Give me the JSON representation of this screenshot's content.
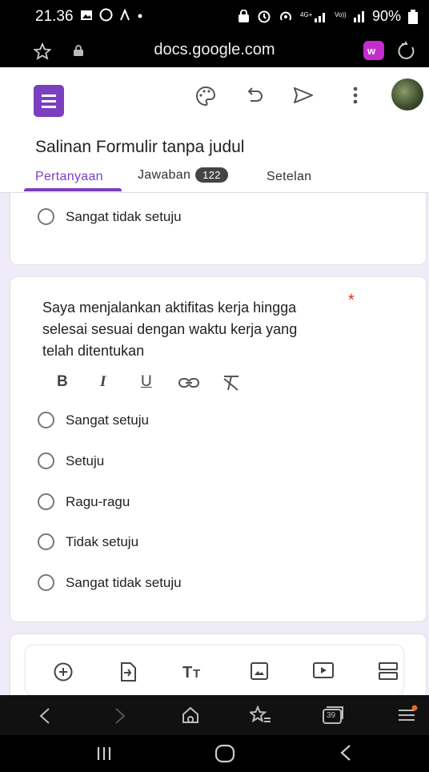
{
  "status": {
    "time": "21.36",
    "battery": "90%"
  },
  "browser": {
    "url": "docs.google.com"
  },
  "app": {
    "form_title": "Salinan Formulir tanpa judul",
    "tabs": [
      {
        "label": "Pertanyaan"
      },
      {
        "label": "Jawaban",
        "badge": "122"
      },
      {
        "label": "Setelan"
      }
    ]
  },
  "prev_card": {
    "option": "Sangat tidak setuju"
  },
  "question_card": {
    "question": "Saya menjalankan aktifitas kerja hingga selesai sesuai dengan waktu kerja yang telah ditentukan",
    "required_mark": "*",
    "format": {
      "bold": "B",
      "italic": "I",
      "underline": "U"
    },
    "options": [
      "Sangat setuju",
      "Setuju",
      "Ragu-ragu",
      "Tidak setuju",
      "Sangat tidak setuju"
    ]
  },
  "browser_nav": {
    "tab_count": "39"
  },
  "icons": [
    "star-icon",
    "lock-icon",
    "palette-icon",
    "undo-icon",
    "send-icon",
    "more-icon",
    "add-question-icon",
    "import-icon",
    "title-icon",
    "image-icon",
    "video-icon",
    "section-icon",
    "back-icon",
    "forward-icon",
    "home-icon",
    "bookmarks-icon",
    "tabs-icon",
    "menu-icon"
  ]
}
